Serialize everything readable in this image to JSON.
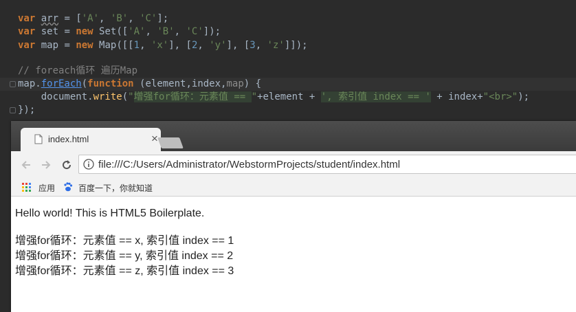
{
  "editor": {
    "line1": {
      "kw": "var",
      "name": "arr",
      "rest1": " = [",
      "s1": "'A'",
      "c1": ", ",
      "s2": "'B'",
      "c2": ", ",
      "s3": "'C'",
      "rest2": "];"
    },
    "line2": {
      "kw": "var",
      "name": " set = ",
      "kw2": "new",
      "rest1": " Set([",
      "s1": "'A'",
      "c1": ", ",
      "s2": "'B'",
      "c2": ", ",
      "s3": "'C'",
      "rest2": "]);"
    },
    "line3": {
      "kw": "var",
      "name": " map = ",
      "kw2": "new",
      "rest1": " Map([[",
      "n1": "1",
      "c1": ", ",
      "s1": "'x'",
      "c2": "], [",
      "n2": "2",
      "c3": ", ",
      "s2": "'y'",
      "c4": "], [",
      "n3": "3",
      "c5": ", ",
      "s3": "'z'",
      "rest2": "]]);"
    },
    "comment": "// foreach循环 遍历Map",
    "line5": {
      "obj": "map.",
      "method": "forEach",
      "p1": "(",
      "kw": "function",
      "p2": " (element,index,",
      "param": "map",
      "p3": ") {"
    },
    "line6": {
      "indent": "    document.",
      "fn": "write",
      "p1": "(",
      "s1": "\"",
      "s2": "增强for循环：元素值 == ",
      "s3": "\"",
      "p2": "+element + ",
      "s4": "', 索引值 index == '",
      "p3": " + index+",
      "s5": "\"<br>\"",
      "p4": ");"
    },
    "line7": "});"
  },
  "browser": {
    "tab_title": "index.html",
    "tab_close": "×",
    "url": "file:///C:/Users/Administrator/WebstormProjects/student/index.html",
    "bookmarks": [
      {
        "label": "应用"
      },
      {
        "label": "百度一下，你就知道"
      }
    ],
    "page": {
      "heading": "Hello world! This is HTML5 Boilerplate.",
      "lines": [
        "增强for循环：元素值 == x, 索引值 index == 1",
        "增强for循环：元素值 == y, 索引值 index == 2",
        "增强for循环：元素值 == z, 索引值 index == 3"
      ]
    }
  }
}
